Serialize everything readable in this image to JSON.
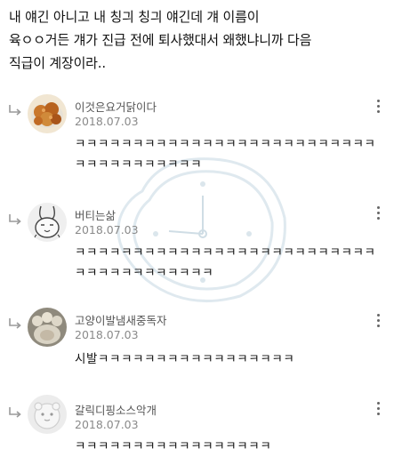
{
  "post": {
    "lines": [
      "내 얘긴 아니고 내 칭긔 칭긔 얘긴데 걔 이름이",
      "육ㅇㅇ거든 걔가 진급 전에 퇴사했대서 왜했냐니까 다음",
      "직급이 계장이라.."
    ]
  },
  "comments": [
    {
      "nickname": "이것은요거닭이다",
      "date": "2018.07.03",
      "text": "ㅋㅋㅋㅋㅋㅋㅋㅋㅋㅋㅋㅋㅋㅋㅋㅋㅋㅋㅋㅋㅋㅋㅋㅋㅋㅋㅋㅋㅋㅋㅋㅋㅋㅋㅋㅋㅋ",
      "avatar": "fried-chicken-photo"
    },
    {
      "nickname": "버티는삶",
      "date": "2018.07.03",
      "text": "ㅋㅋㅋㅋㅋㅋㅋㅋㅋㅋㅋㅋㅋㅋㅋㅋㅋㅋㅋㅋㅋㅋㅋㅋㅋㅋㅋㅋㅋㅋㅋㅋㅋㅋㅋㅋㅋㅋ",
      "avatar": "bunny-doodle"
    },
    {
      "nickname": "고양이발냄새중독자",
      "date": "2018.07.03",
      "text": "시발ㅋㅋㅋㅋㅋㅋㅋㅋㅋㅋㅋㅋㅋㅋㅋㅋㅋ",
      "avatar": "cat-paw-photo"
    },
    {
      "nickname": "갈릭디핑소스악개",
      "date": "2018.07.03",
      "text": "ㅋㅋㅋㅋㅋㅋㅋㅋㅋㅋㅋㅋㅋㅋㅋㅋㅋ",
      "avatar": "default-character"
    }
  ],
  "icons": {
    "reply": "reply-arrow-icon",
    "more": "more-vertical-icon"
  },
  "colors": {
    "text": "#111111",
    "nickname": "#555555",
    "date": "#8a8a8a",
    "reply_arrow": "#9a9a9a"
  }
}
